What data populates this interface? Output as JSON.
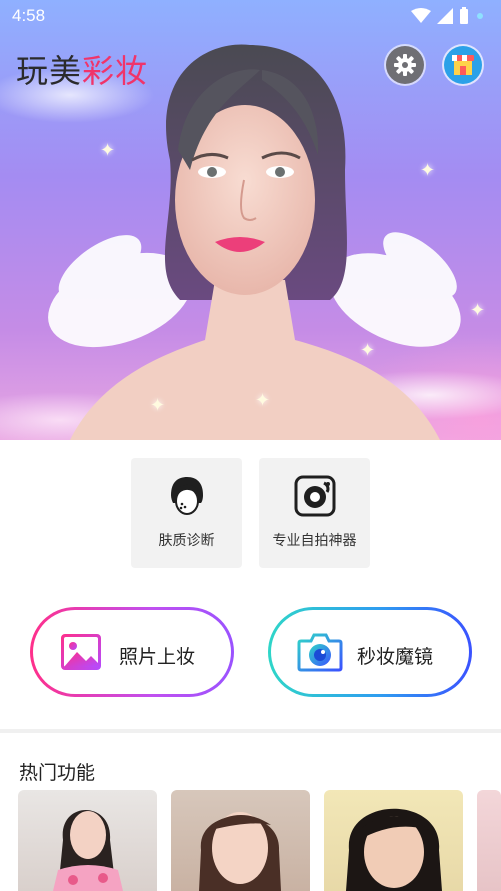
{
  "status_bar": {
    "time": "4:58"
  },
  "header": {
    "title_part1": "玩美",
    "title_part2": "彩妆"
  },
  "icons": {
    "settings": "gear-icon",
    "shop": "shop-icon",
    "skin": "face-scan-icon",
    "selfie": "selfie-camera-icon",
    "makeup": "image-icon",
    "mirror": "camera-icon"
  },
  "tools": [
    {
      "label": "肤质诊断"
    },
    {
      "label": "专业自拍神器"
    }
  ],
  "actions": [
    {
      "label": "照片上妆"
    },
    {
      "label": "秒妆魔镜"
    }
  ],
  "hot": {
    "title": "热门功能"
  },
  "colors": {
    "title_dark": "#2b2b2b",
    "title_accent": "#f0346a",
    "makeup_gradient": [
      "#ff2f8a",
      "#9a52ff"
    ],
    "mirror_gradient": [
      "#2fd6c8",
      "#3a52ff"
    ]
  }
}
